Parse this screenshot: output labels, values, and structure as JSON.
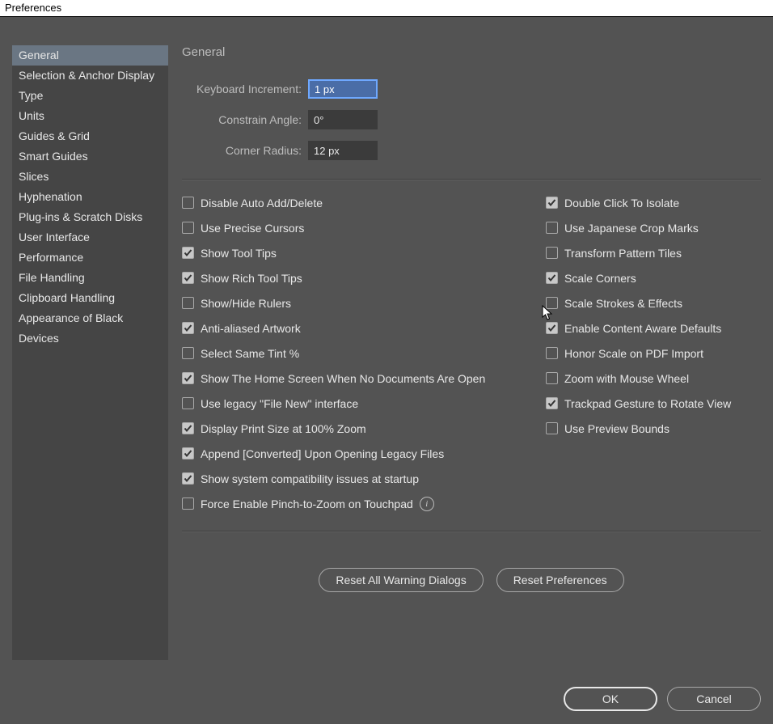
{
  "window": {
    "title": "Preferences"
  },
  "sidebar": {
    "items": [
      {
        "label": "General",
        "selected": true
      },
      {
        "label": "Selection & Anchor Display"
      },
      {
        "label": "Type"
      },
      {
        "label": "Units"
      },
      {
        "label": "Guides & Grid"
      },
      {
        "label": "Smart Guides"
      },
      {
        "label": "Slices"
      },
      {
        "label": "Hyphenation"
      },
      {
        "label": "Plug-ins & Scratch Disks"
      },
      {
        "label": "User Interface"
      },
      {
        "label": "Performance"
      },
      {
        "label": "File Handling"
      },
      {
        "label": "Clipboard Handling"
      },
      {
        "label": "Appearance of Black"
      },
      {
        "label": "Devices"
      }
    ]
  },
  "pane": {
    "title": "General",
    "fields": {
      "keyboard_increment": {
        "label": "Keyboard Increment:",
        "value": "1 px",
        "selected": true
      },
      "constrain_angle": {
        "label": "Constrain Angle:",
        "value": "0°"
      },
      "corner_radius": {
        "label": "Corner Radius:",
        "value": "12 px"
      }
    },
    "left_checks": [
      {
        "label": "Disable Auto Add/Delete",
        "checked": false
      },
      {
        "label": "Use Precise Cursors",
        "checked": false
      },
      {
        "label": "Show Tool Tips",
        "checked": true
      },
      {
        "label": "Show Rich Tool Tips",
        "checked": true
      },
      {
        "label": "Show/Hide Rulers",
        "checked": false
      },
      {
        "label": "Anti-aliased Artwork",
        "checked": true
      },
      {
        "label": "Select Same Tint %",
        "checked": false
      },
      {
        "label": "Show The Home Screen When No Documents Are Open",
        "checked": true
      },
      {
        "label": "Use legacy \"File New\" interface",
        "checked": false
      },
      {
        "label": "Display Print Size at 100% Zoom",
        "checked": true
      },
      {
        "label": "Append [Converted] Upon Opening Legacy Files",
        "checked": true
      },
      {
        "label": "Show system compatibility issues at startup",
        "checked": true
      },
      {
        "label": "Force Enable Pinch-to-Zoom on Touchpad",
        "checked": false,
        "info": true
      }
    ],
    "right_checks": [
      {
        "label": "Double Click To Isolate",
        "checked": true
      },
      {
        "label": "Use Japanese Crop Marks",
        "checked": false
      },
      {
        "label": "Transform Pattern Tiles",
        "checked": false
      },
      {
        "label": "Scale Corners",
        "checked": true
      },
      {
        "label": "Scale Strokes & Effects",
        "checked": false
      },
      {
        "label": "Enable Content Aware Defaults",
        "checked": true
      },
      {
        "label": "Honor Scale on PDF Import",
        "checked": false
      },
      {
        "label": "Zoom with Mouse Wheel",
        "checked": false
      },
      {
        "label": "Trackpad Gesture to Rotate View",
        "checked": true
      },
      {
        "label": "Use Preview Bounds",
        "checked": false
      }
    ],
    "buttons": {
      "reset_warnings": "Reset All Warning Dialogs",
      "reset_prefs": "Reset Preferences"
    }
  },
  "footer": {
    "ok": "OK",
    "cancel": "Cancel"
  }
}
